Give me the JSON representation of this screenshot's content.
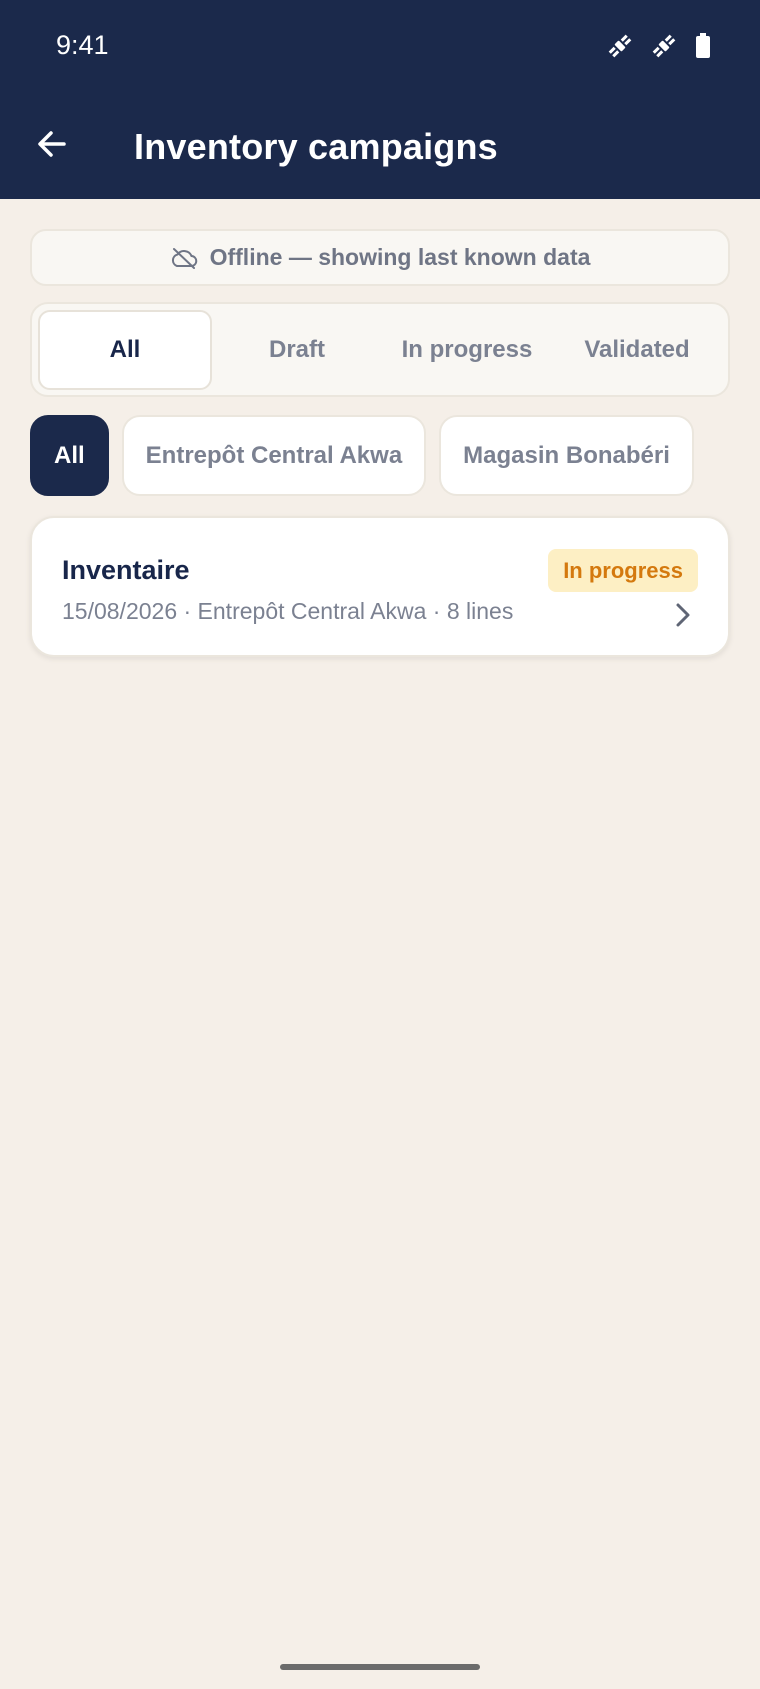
{
  "status_bar": {
    "time": "9:41",
    "icons": [
      "satellite-icon",
      "satellite-icon",
      "battery-icon"
    ]
  },
  "app_bar": {
    "back_icon": "arrow-left-icon",
    "title": "Inventory campaigns",
    "background": "#1b294b"
  },
  "offline_banner": {
    "icon": "cloud-off-icon",
    "text": "Offline — showing last known data"
  },
  "status_tabs": [
    {
      "label": "All",
      "active": true
    },
    {
      "label": "Draft",
      "active": false
    },
    {
      "label": "In progress",
      "active": false
    },
    {
      "label": "Validated",
      "active": false
    }
  ],
  "location_chips": [
    {
      "label": "All",
      "active": true
    },
    {
      "label": "Entrepôt Central Akwa",
      "active": false
    },
    {
      "label": "Magasin Bonabéri",
      "active": false
    }
  ],
  "campaigns": [
    {
      "title": "Inventaire",
      "meta": "15/08/2026 · Entrepôt Central Akwa · 8 lines",
      "status": "In progress",
      "status_color": "#d4790e",
      "status_bg": "#fdefc4",
      "icon": "chevron-right-icon"
    }
  ]
}
